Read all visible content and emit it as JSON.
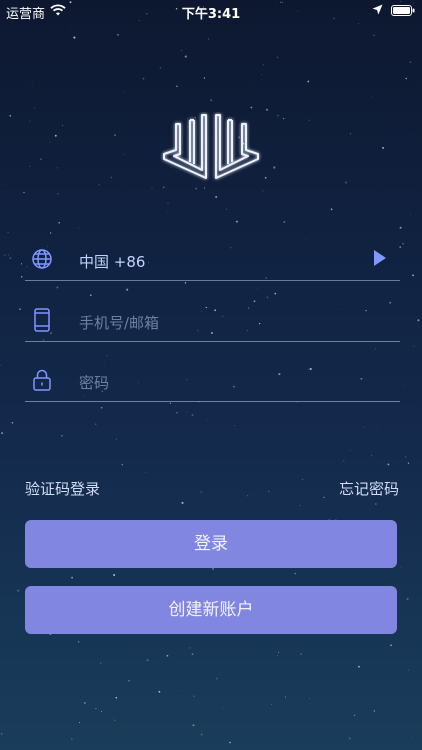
{
  "status_bar": {
    "carrier": "运营商",
    "time": "下午3:41"
  },
  "form": {
    "country": {
      "value": "中国 +86",
      "icon": "globe-icon"
    },
    "account": {
      "placeholder": "手机号/邮箱",
      "icon": "phone-icon"
    },
    "password": {
      "placeholder": "密码",
      "icon": "lock-icon"
    }
  },
  "links": {
    "code_login": "验证码登录",
    "forgot_password": "忘记密码"
  },
  "buttons": {
    "login": "登录",
    "create_account": "创建新账户"
  },
  "colors": {
    "background_top": "#0d1830",
    "background_bottom": "#1a3d5a",
    "button": "#8187e0",
    "accent": "#7f97ff",
    "field_value": "#c4d2ff",
    "placeholder": "#6f7fa3"
  }
}
